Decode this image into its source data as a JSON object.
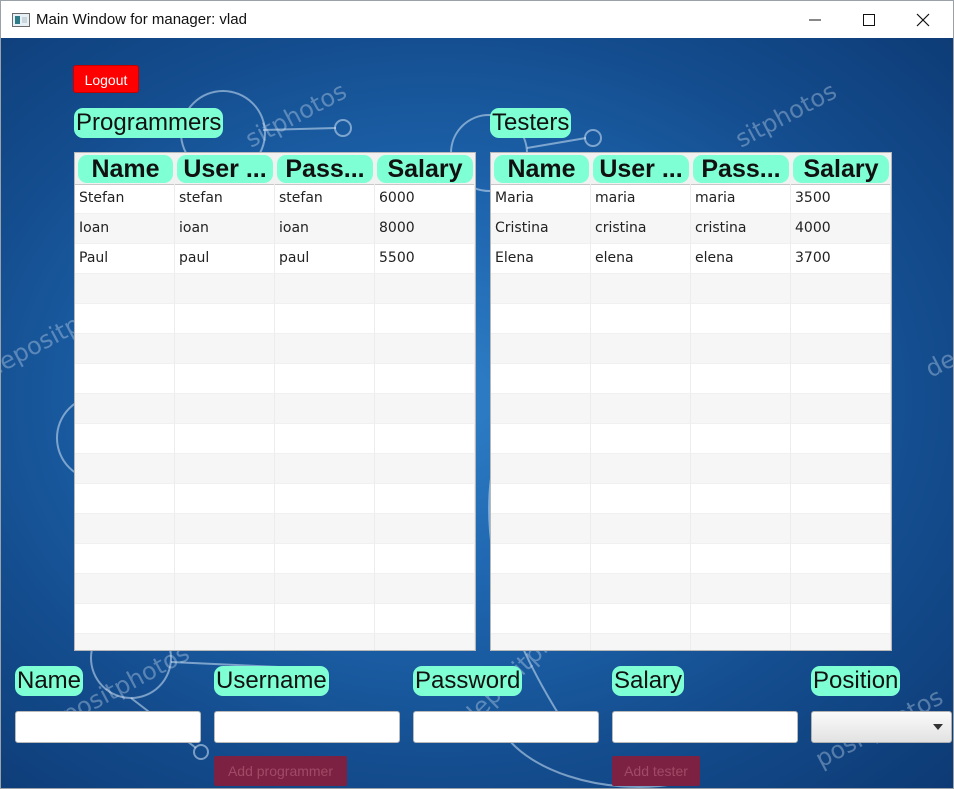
{
  "window": {
    "title": "Main Window for manager: vlad",
    "minimize_icon": "minimize-icon",
    "maximize_icon": "maximize-icon",
    "close_icon": "close-icon"
  },
  "background": {
    "watermark": "depositphotos",
    "colors": [
      "#0d3a74",
      "#1e65ae",
      "#2f7fc6"
    ]
  },
  "logout_label": "Logout",
  "programmers": {
    "label": "Programmers",
    "columns": [
      "Name",
      "User ...",
      "Pass...",
      "Salary"
    ],
    "rows": [
      [
        "Stefan",
        "stefan",
        "stefan",
        "6000"
      ],
      [
        "Ioan",
        "ioan",
        "ioan",
        "8000"
      ],
      [
        "Paul",
        "paul",
        "paul",
        "5500"
      ]
    ]
  },
  "testers": {
    "label": "Testers",
    "columns": [
      "Name",
      "User ...",
      "Pass...",
      "Salary"
    ],
    "rows": [
      [
        "Maria",
        "maria",
        "maria",
        "3500"
      ],
      [
        "Cristina",
        "cristina",
        "cristina",
        "4000"
      ],
      [
        "Elena",
        "elena",
        "elena",
        "3700"
      ]
    ]
  },
  "form": {
    "name_label": "Name",
    "username_label": "Username",
    "password_label": "Password",
    "salary_label": "Salary",
    "position_label": "Position",
    "name_value": "",
    "username_value": "",
    "password_value": "",
    "salary_value": "",
    "position_value": ""
  },
  "add_programmer_label": "Add programmer",
  "add_tester_label": "Add tester",
  "accent_colors": {
    "tag": "#7fffd4",
    "logout": "#ff0000",
    "add_button": "#7c2142"
  }
}
